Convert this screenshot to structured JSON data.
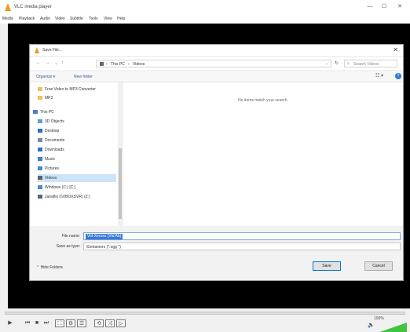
{
  "app": {
    "title": "VLC media player",
    "brand_color": "#f39a1d"
  },
  "window_controls": {
    "minimize": "—",
    "maximize": "☐",
    "close": "✕"
  },
  "menu": [
    "Media",
    "Playback",
    "Audio",
    "Video",
    "Subtitle",
    "Tools",
    "View",
    "Help"
  ],
  "dialog": {
    "title": "Save File...",
    "close": "✕",
    "nav": {
      "back": "←",
      "forward": "→",
      "up": "↑",
      "history": "⌄"
    },
    "breadcrumb": [
      "This PC",
      "Videos"
    ],
    "separator": "›",
    "search_placeholder": "Search Videos",
    "toolbar": {
      "organize": "Organize ▾",
      "new_folder": "New folder",
      "help": "?"
    },
    "nav_items": [
      {
        "label": "Free Video to MP3 Converter",
        "icon": "folder-icon",
        "color": "#e8c35a"
      },
      {
        "label": "MP3",
        "icon": "folder-icon",
        "color": "#e8c35a"
      },
      {
        "label": "This PC",
        "icon": "pc-icon",
        "color": "#4a7fc1"
      },
      {
        "label": "3D Objects",
        "icon": "cube-icon",
        "color": "#5aa0d8"
      },
      {
        "label": "Desktop",
        "icon": "desktop-icon",
        "color": "#2b6fc4"
      },
      {
        "label": "Documents",
        "icon": "documents-icon",
        "color": "#7a8aa0"
      },
      {
        "label": "Downloads",
        "icon": "download-icon",
        "color": "#2f6fcf"
      },
      {
        "label": "Music",
        "icon": "music-icon",
        "color": "#3f7fd0"
      },
      {
        "label": "Pictures",
        "icon": "pictures-icon",
        "color": "#3f8fc0"
      },
      {
        "label": "Videos",
        "icon": "videos-icon",
        "color": "#5a6070",
        "selected": true
      },
      {
        "label": "Windows (C:) [C:]",
        "icon": "drive-icon",
        "color": "#4a8ad0"
      },
      {
        "label": "Janaflix (\\\\VBOXSVR) (Z:)",
        "icon": "network-drive-icon",
        "color": "#4a6a8a"
      }
    ],
    "empty_message": "No items match your search.",
    "file_name_label": "File name:",
    "file_name_value": "Vid-Xeroxx (Vid Ab)",
    "save_as_type_label": "Save as type:",
    "save_as_type_value": "Containers (*.ogg *)",
    "hide_folders": "⌃ Hide Folders",
    "save_button": "Save",
    "cancel_button": "Cancel"
  },
  "controls": {
    "play": "▶",
    "prev": "⏮",
    "stop": "■",
    "next": "⏭",
    "fullscreen": "⛶",
    "playlist": "☰",
    "extended": "⚙",
    "loop": "⟲",
    "random": "⤨",
    "volume_label": "100%",
    "speaker": "🔈",
    "volume_color": "#3fc43f"
  }
}
